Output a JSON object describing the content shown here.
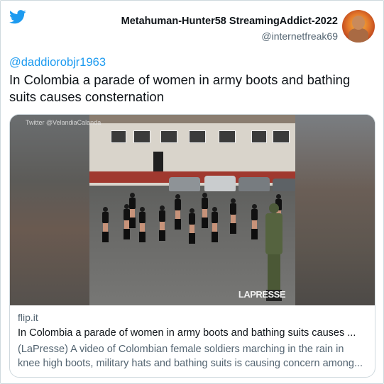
{
  "header": {
    "display_name": "Metahuman-Hunter58 StreamingAddict-2022",
    "handle": "@internetfreak69"
  },
  "tweet": {
    "mention": "@daddiorobjr1963",
    "text": "In Colombia a parade of women in army boots and bathing suits causes consternation"
  },
  "link_card": {
    "media_watermark_top": "Twitter @VelandiaCalanda",
    "media_watermark_bottom": "LAPRESSE",
    "domain": "flip.it",
    "title": "In Colombia a parade of women in army boots and bathing suits causes ...",
    "description": "(LaPresse) A video of Colombian female soldiers marching in the rain in knee high boots, military hats and bathing suits is causing concern among..."
  },
  "colors": {
    "twitter_blue": "#1d9bf0",
    "text_primary": "#0f1419",
    "text_secondary": "#536471",
    "border": "#cfd9de"
  },
  "icons": [
    "twitter-bird-icon"
  ]
}
